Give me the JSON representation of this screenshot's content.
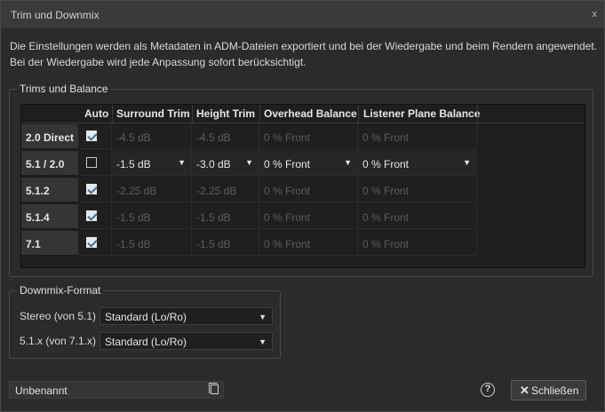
{
  "window": {
    "title": "Trim und Downmix",
    "close_glyph": "x"
  },
  "description": "Die Einstellungen werden als Metadaten in ADM-Dateien exportiert und bei der Wiedergabe und beim Rendern angewendet. Bei der Wiedergabe wird jede Anpassung sofort berücksichtigt.",
  "trims": {
    "legend": "Trims und Balance",
    "headers": {
      "auto": "Auto",
      "surround": "Surround Trim",
      "height": "Height Trim",
      "overhead": "Overhead Balance",
      "listener": "Listener Plane Balance"
    },
    "rows": [
      {
        "label": "2.0 Direct",
        "auto": true,
        "surround": "-4.5 dB",
        "height": "-4.5 dB",
        "overhead": "0 % Front",
        "listener": "0 % Front"
      },
      {
        "label": "5.1 / 2.0",
        "auto": false,
        "surround": "-1.5 dB",
        "height": "-3.0 dB",
        "overhead": "0 % Front",
        "listener": "0 % Front"
      },
      {
        "label": "5.1.2",
        "auto": true,
        "surround": "-2.25 dB",
        "height": "-2.25 dB",
        "overhead": "0 % Front",
        "listener": "0 % Front"
      },
      {
        "label": "5.1.4",
        "auto": true,
        "surround": "-1.5 dB",
        "height": "-1.5 dB",
        "overhead": "0 % Front",
        "listener": "0 % Front"
      },
      {
        "label": "7.1",
        "auto": true,
        "surround": "-1.5 dB",
        "height": "-1.5 dB",
        "overhead": "0 % Front",
        "listener": "0 % Front"
      }
    ]
  },
  "downmix": {
    "legend": "Downmix-Format",
    "stereo_label": "Stereo (von 5.1)",
    "stereo_value": "Standard (Lo/Ro)",
    "surround_label": "5.1.x (von 7.1.x)",
    "surround_value": "Standard (Lo/Ro)"
  },
  "footer": {
    "preset_name": "Unbenannt",
    "help_glyph": "?",
    "close_label": "Schließen",
    "close_glyph": "✕"
  },
  "icons": {
    "dropdown": "chevron-down-icon",
    "preset": "document-icon",
    "help": "help-icon"
  }
}
